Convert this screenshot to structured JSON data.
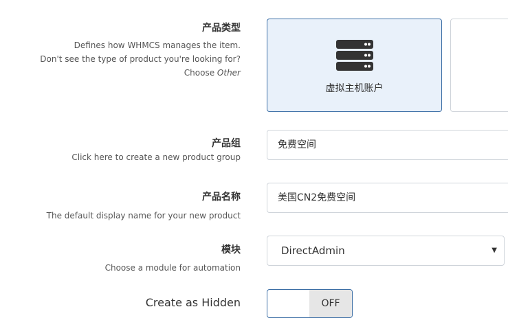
{
  "product_type": {
    "title": "产品类型",
    "help_line1": "Defines how WHMCS manages the item.",
    "help_line2": "Don't see the type of product you're looking for?",
    "help_line3_prefix": "Choose ",
    "help_line3_em": "Other",
    "options": [
      {
        "label": "虚拟主机账户",
        "icon": "server-icon",
        "selected": true
      },
      {
        "label": "",
        "icon": "",
        "selected": false
      }
    ]
  },
  "product_group": {
    "title": "产品组",
    "help": "Click here to create a new product group",
    "value": "免费空间"
  },
  "product_name": {
    "title": "产品名称",
    "help": "The default display name for your new product",
    "value": "美国CN2免费空间"
  },
  "module": {
    "title": "模块",
    "help": "Choose a module for automation",
    "selected": "DirectAdmin"
  },
  "create_hidden": {
    "title": "Create as Hidden",
    "toggle_state": "OFF"
  },
  "colors": {
    "selected_border": "#3b6ea5",
    "selected_bg": "#e9f1fa",
    "icon_dark": "#333333"
  }
}
